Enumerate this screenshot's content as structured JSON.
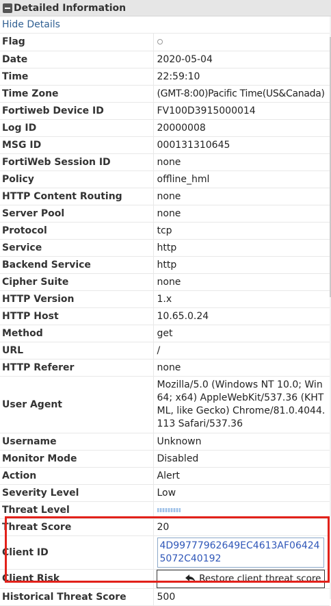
{
  "header": {
    "title": "Detailed Information",
    "collapse_icon": "minus-square-icon"
  },
  "hide_details_label": "Hide Details",
  "rows": {
    "flag": {
      "key": "Flag",
      "value": ""
    },
    "date": {
      "key": "Date",
      "value": "2020-05-04"
    },
    "time": {
      "key": "Time",
      "value": "22:59:10"
    },
    "timezone": {
      "key": "Time Zone",
      "value": "(GMT-8:00)Pacific Time(US&Canada)"
    },
    "device_id": {
      "key": "Fortiweb Device ID",
      "value": "FV100D3915000014"
    },
    "log_id": {
      "key": "Log ID",
      "value": "20000008"
    },
    "msg_id": {
      "key": "MSG ID",
      "value": "000131310645"
    },
    "session_id": {
      "key": "FortiWeb Session ID",
      "value": "none"
    },
    "policy": {
      "key": "Policy",
      "value": "offline_hml"
    },
    "content_routing": {
      "key": "HTTP Content Routing",
      "value": "none"
    },
    "server_pool": {
      "key": "Server Pool",
      "value": "none"
    },
    "protocol": {
      "key": "Protocol",
      "value": "tcp"
    },
    "service": {
      "key": "Service",
      "value": "http"
    },
    "backend_service": {
      "key": "Backend Service",
      "value": "http"
    },
    "cipher_suite": {
      "key": "Cipher Suite",
      "value": "none"
    },
    "http_version": {
      "key": "HTTP Version",
      "value": "1.x"
    },
    "http_host": {
      "key": "HTTP Host",
      "value": "10.65.0.24"
    },
    "method": {
      "key": "Method",
      "value": "get"
    },
    "url": {
      "key": "URL",
      "value": "/"
    },
    "referer": {
      "key": "HTTP Referer",
      "value": "none"
    },
    "user_agent": {
      "key": "User Agent",
      "value": "Mozilla/5.0 (Windows NT 10.0; Win64; x64) AppleWebKit/537.36 (KHTML, like Gecko) Chrome/81.0.4044.113 Safari/537.36"
    },
    "username": {
      "key": "Username",
      "value": "Unknown"
    },
    "monitor_mode": {
      "key": "Monitor Mode",
      "value": "Disabled"
    },
    "action": {
      "key": "Action",
      "value": "Alert"
    },
    "severity": {
      "key": "Severity Level",
      "value": "Low"
    },
    "threat_level": {
      "key": "Threat Level",
      "value": ""
    },
    "threat_score": {
      "key": "Threat Score",
      "value": "20"
    },
    "client_id": {
      "key": "Client ID",
      "value": "4D99777962649EC4613AF064245072C40192"
    },
    "client_risk": {
      "key": "Client Risk",
      "button_label": "Restore client threat score",
      "button_icon": "undo-arrow-icon"
    },
    "historical_threat_score": {
      "key": "Historical Threat Score",
      "value": "500"
    }
  },
  "colors": {
    "highlight": "#e2211a",
    "link": "#2f5f92",
    "client_id": "#2e56b8"
  }
}
